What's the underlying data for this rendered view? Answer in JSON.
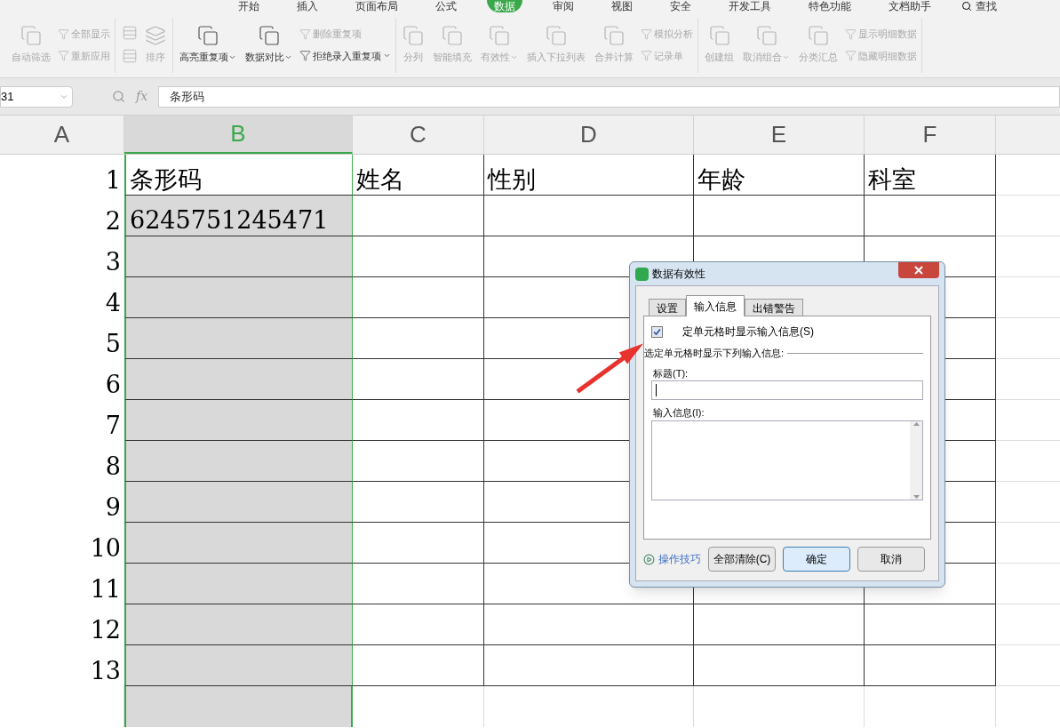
{
  "menu_tabs": [
    {
      "label": "开始",
      "selected": false
    },
    {
      "label": "插入",
      "selected": false
    },
    {
      "label": "页面布局",
      "selected": false
    },
    {
      "label": "公式",
      "selected": false
    },
    {
      "label": "数据",
      "selected": true
    },
    {
      "label": "审阅",
      "selected": false
    },
    {
      "label": "视图",
      "selected": false
    },
    {
      "label": "安全",
      "selected": false
    },
    {
      "label": "开发工具",
      "selected": false
    },
    {
      "label": "特色功能",
      "selected": false
    },
    {
      "label": "文档助手",
      "selected": false
    }
  ],
  "search_label": "查找",
  "ribbon_groups": [
    {
      "items": [
        {
          "kind": "large",
          "label": "自动筛选",
          "disabled": true,
          "dropdown": false
        },
        {
          "kind": "pair",
          "labels": [
            "全部显示",
            "重新应用"
          ],
          "disabled": true
        }
      ]
    },
    {
      "items": [
        {
          "kind": "sort",
          "label": "排序",
          "disabled": true,
          "dropdown": false
        }
      ]
    },
    {
      "items": [
        {
          "kind": "large",
          "label": "高亮重复项",
          "disabled": false,
          "dropdown": true
        },
        {
          "kind": "large",
          "label": "数据对比",
          "disabled": false,
          "dropdown": true
        },
        {
          "kind": "pair2",
          "labels": [
            "删除重复项",
            "拒绝录入重复项"
          ],
          "disabled_first": true,
          "dropdown": true
        }
      ]
    },
    {
      "items": [
        {
          "kind": "large",
          "label": "分列",
          "disabled": true,
          "dropdown": false
        },
        {
          "kind": "large",
          "label": "智能填充",
          "disabled": true,
          "dropdown": false
        },
        {
          "kind": "large",
          "label": "有效性",
          "disabled": true,
          "dropdown": true
        },
        {
          "kind": "large",
          "label": "插入下拉列表",
          "disabled": true,
          "dropdown": false
        },
        {
          "kind": "large",
          "label": "合并计算",
          "disabled": true,
          "dropdown": false
        },
        {
          "kind": "pair",
          "labels": [
            "模拟分析",
            "记录单"
          ],
          "disabled": true
        }
      ]
    },
    {
      "items": [
        {
          "kind": "large",
          "label": "创建组",
          "disabled": true,
          "dropdown": false
        },
        {
          "kind": "large",
          "label": "取消组合",
          "disabled": true,
          "dropdown": true
        },
        {
          "kind": "large",
          "label": "分类汇总",
          "disabled": true,
          "dropdown": false
        },
        {
          "kind": "pair",
          "labels": [
            "显示明细数据",
            "隐藏明细数据"
          ],
          "disabled": true
        }
      ]
    }
  ],
  "name_box": "31",
  "fx_label": "fx",
  "formula": "条形码",
  "columns": [
    {
      "label": "A",
      "selected": false
    },
    {
      "label": "B",
      "selected": true
    },
    {
      "label": "C",
      "selected": false
    },
    {
      "label": "D",
      "selected": false
    },
    {
      "label": "E",
      "selected": false
    },
    {
      "label": "F",
      "selected": false
    }
  ],
  "rows": [
    [
      "1",
      "条形码",
      "姓名",
      "性别",
      "年龄",
      "科室"
    ],
    [
      "2",
      "6245751245471",
      "",
      "",
      "",
      ""
    ],
    [
      "3",
      "",
      "",
      "",
      "",
      ""
    ],
    [
      "4",
      "",
      "",
      "",
      "",
      ""
    ],
    [
      "5",
      "",
      "",
      "",
      "",
      ""
    ],
    [
      "6",
      "",
      "",
      "",
      "",
      ""
    ],
    [
      "7",
      "",
      "",
      "",
      "",
      ""
    ],
    [
      "8",
      "",
      "",
      "",
      "",
      ""
    ],
    [
      "9",
      "",
      "",
      "",
      "",
      ""
    ],
    [
      "10",
      "",
      "",
      "",
      "",
      ""
    ],
    [
      "11",
      "",
      "",
      "",
      "",
      ""
    ],
    [
      "12",
      "",
      "",
      "",
      "",
      ""
    ],
    [
      "13",
      "",
      "",
      "",
      "",
      ""
    ]
  ],
  "dialog": {
    "title": "数据有效性",
    "tabs": [
      {
        "label": "设置",
        "selected": false
      },
      {
        "label": "输入信息",
        "selected": true
      },
      {
        "label": "出错警告",
        "selected": false
      }
    ],
    "show_checkbox": {
      "label": "定单元格时显示输入信息(S)",
      "checked": true
    },
    "section_label": "选定单元格时显示下列输入信息:",
    "title_label": "标题(T):",
    "message_label": "输入信息(I):",
    "tips_link": "操作技巧",
    "buttons": [
      {
        "label": "全部清除(C)",
        "default": false
      },
      {
        "label": "确定",
        "default": true
      },
      {
        "label": "取消",
        "default": false
      }
    ]
  }
}
